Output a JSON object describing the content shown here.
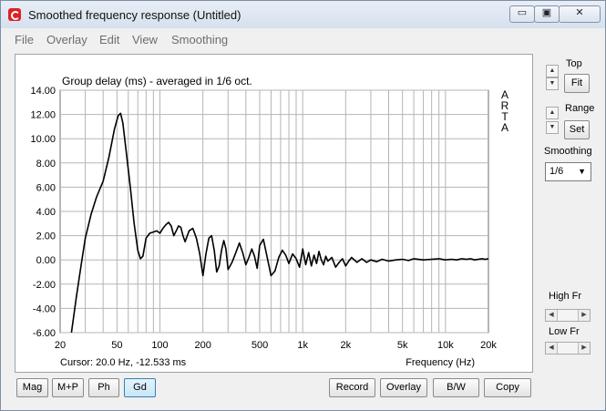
{
  "window": {
    "title": "Smoothed frequency response (Untitled)",
    "minimize_glyph": "▭",
    "maximize_glyph": "▣",
    "close_glyph": "✕"
  },
  "menu": [
    "File",
    "Overlay",
    "Edit",
    "View",
    "Smoothing"
  ],
  "side": {
    "top_label": "Top",
    "fit_button": "Fit",
    "range_label": "Range",
    "set_button": "Set",
    "smoothing_label": "Smoothing",
    "smoothing_value": "1/6",
    "high_fr_label": "High Fr",
    "low_fr_label": "Low Fr"
  },
  "bottom_buttons": {
    "mag": "Mag",
    "mp": "M+P",
    "ph": "Ph",
    "gd": "Gd",
    "record": "Record",
    "overlay": "Overlay",
    "bw": "B/W",
    "copy": "Copy"
  },
  "chart_data": {
    "type": "line",
    "title": "Group delay (ms) - averaged in 1/6 oct.",
    "watermark": "ARTA",
    "xlabel": "Frequency (Hz)",
    "ylabel": "",
    "xscale": "log",
    "xlim": [
      20,
      20000
    ],
    "ylim": [
      -6,
      14
    ],
    "yticks": [
      "14.00",
      "12.00",
      "10.00",
      "8.00",
      "6.00",
      "4.00",
      "2.00",
      "0.00",
      "-2.00",
      "-4.00",
      "-6.00"
    ],
    "xticks": [
      {
        "value": 20,
        "label": "20"
      },
      {
        "value": 50,
        "label": "50"
      },
      {
        "value": 100,
        "label": "100"
      },
      {
        "value": 200,
        "label": "200"
      },
      {
        "value": 500,
        "label": "500"
      },
      {
        "value": 1000,
        "label": "1k"
      },
      {
        "value": 2000,
        "label": "2k"
      },
      {
        "value": 5000,
        "label": "5k"
      },
      {
        "value": 10000,
        "label": "10k"
      },
      {
        "value": 20000,
        "label": "20k"
      }
    ],
    "cursor_text": "Cursor: 20.0 Hz, -12.533 ms",
    "grid": true,
    "series": [
      {
        "color": "#000000",
        "x": [
          24,
          26,
          28,
          30,
          33,
          36,
          40,
          44,
          48,
          51,
          53,
          55,
          58,
          62,
          66,
          70,
          73,
          76,
          80,
          85,
          90,
          95,
          100,
          105,
          110,
          115,
          120,
          125,
          130,
          135,
          140,
          145,
          150,
          160,
          170,
          180,
          190,
          200,
          210,
          220,
          230,
          240,
          250,
          260,
          270,
          280,
          290,
          300,
          320,
          340,
          360,
          380,
          400,
          420,
          440,
          460,
          480,
          500,
          530,
          560,
          600,
          640,
          680,
          720,
          760,
          800,
          850,
          900,
          950,
          1000,
          1050,
          1100,
          1150,
          1200,
          1250,
          1300,
          1350,
          1400,
          1450,
          1500,
          1600,
          1700,
          1800,
          1900,
          2000,
          2100,
          2200,
          2400,
          2600,
          2800,
          3000,
          3300,
          3600,
          4000,
          4500,
          5000,
          5500,
          6000,
          7000,
          8000,
          9000,
          10000,
          11000,
          12000,
          13000,
          14000,
          15000,
          16000,
          17000,
          18000,
          19000,
          20000
        ],
        "y": [
          -6.0,
          -3.0,
          -0.5,
          1.8,
          3.8,
          5.2,
          6.5,
          8.5,
          10.8,
          11.9,
          12.1,
          11.3,
          9.0,
          6.0,
          3.0,
          0.8,
          0.1,
          0.3,
          1.8,
          2.2,
          2.3,
          2.4,
          2.2,
          2.6,
          2.9,
          3.1,
          2.8,
          2.0,
          2.4,
          2.8,
          2.7,
          2.0,
          1.5,
          2.4,
          2.6,
          1.8,
          0.5,
          -1.3,
          0.5,
          1.8,
          2.0,
          0.8,
          -1.0,
          -0.5,
          0.8,
          1.6,
          0.9,
          -0.8,
          -0.2,
          0.6,
          1.4,
          0.6,
          -0.4,
          0.2,
          0.9,
          0.3,
          -0.7,
          1.2,
          1.7,
          0.4,
          -1.3,
          -0.9,
          0.2,
          0.8,
          0.4,
          -0.3,
          0.5,
          0.1,
          -0.6,
          0.9,
          -0.4,
          0.6,
          -0.5,
          0.4,
          -0.3,
          0.7,
          0.0,
          -0.4,
          0.3,
          -0.1,
          0.2,
          -0.6,
          -0.2,
          0.1,
          -0.5,
          -0.1,
          0.2,
          -0.2,
          0.1,
          -0.2,
          0.0,
          -0.15,
          0.05,
          -0.1,
          0.0,
          0.05,
          -0.05,
          0.1,
          0.0,
          0.05,
          0.1,
          0.0,
          0.05,
          0.0,
          0.1,
          0.05,
          0.1,
          0.0,
          0.05,
          0.1,
          0.05,
          0.1
        ]
      }
    ]
  }
}
